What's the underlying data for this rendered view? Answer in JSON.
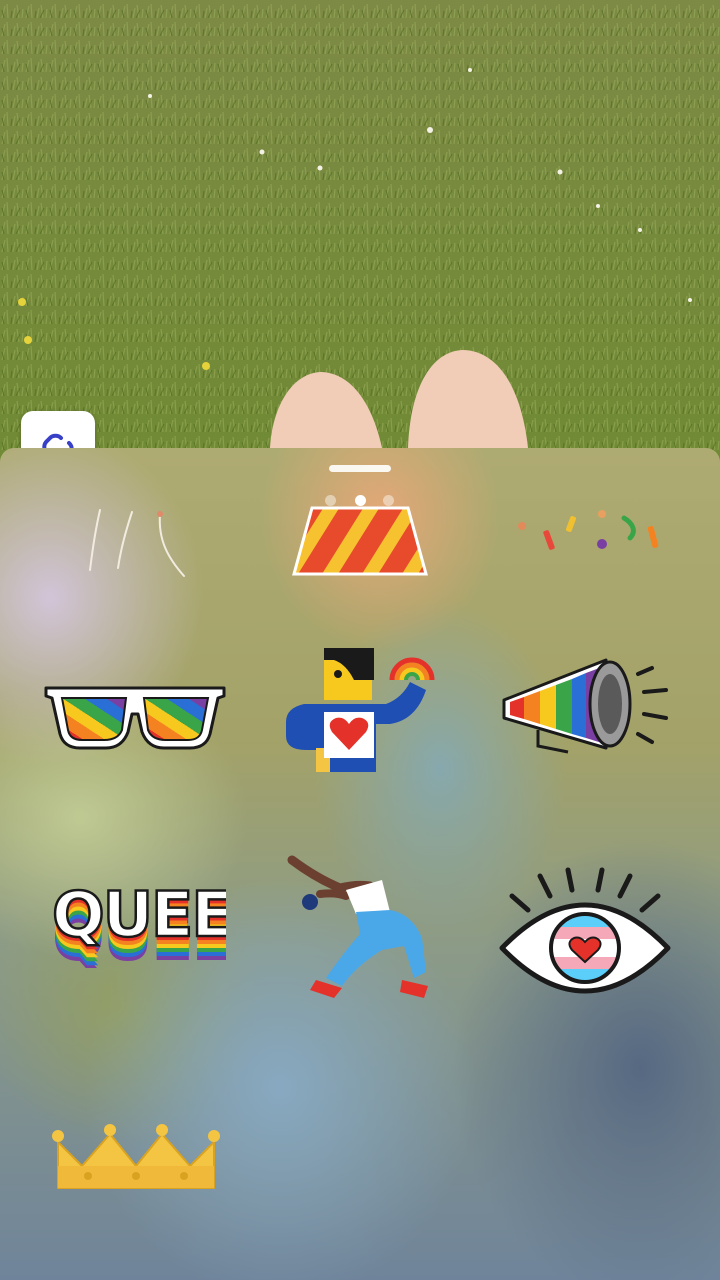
{
  "sticker_tray": {
    "page_indicator": {
      "pages": 3,
      "active_index": 1
    },
    "stickers": [
      {
        "name": "streamer-lines"
      },
      {
        "name": "striped-float"
      },
      {
        "name": "confetti"
      },
      {
        "name": "rainbow-sunglasses"
      },
      {
        "name": "person-with-rainbow-heart"
      },
      {
        "name": "rainbow-megaphone"
      },
      {
        "name": "queer-text"
      },
      {
        "name": "dancer"
      },
      {
        "name": "trans-flag-eye"
      },
      {
        "name": "golden-crown"
      }
    ],
    "sticker_text": {
      "queer": "QUEER"
    }
  },
  "colors": {
    "rainbow": [
      "#e4312a",
      "#f58220",
      "#f7c81e",
      "#3aa548",
      "#2a6fd6",
      "#7a3fa2"
    ],
    "trans_flag": [
      "#5bcefa",
      "#f5a9b8",
      "#ffffff"
    ],
    "gold": "#f4c542"
  }
}
